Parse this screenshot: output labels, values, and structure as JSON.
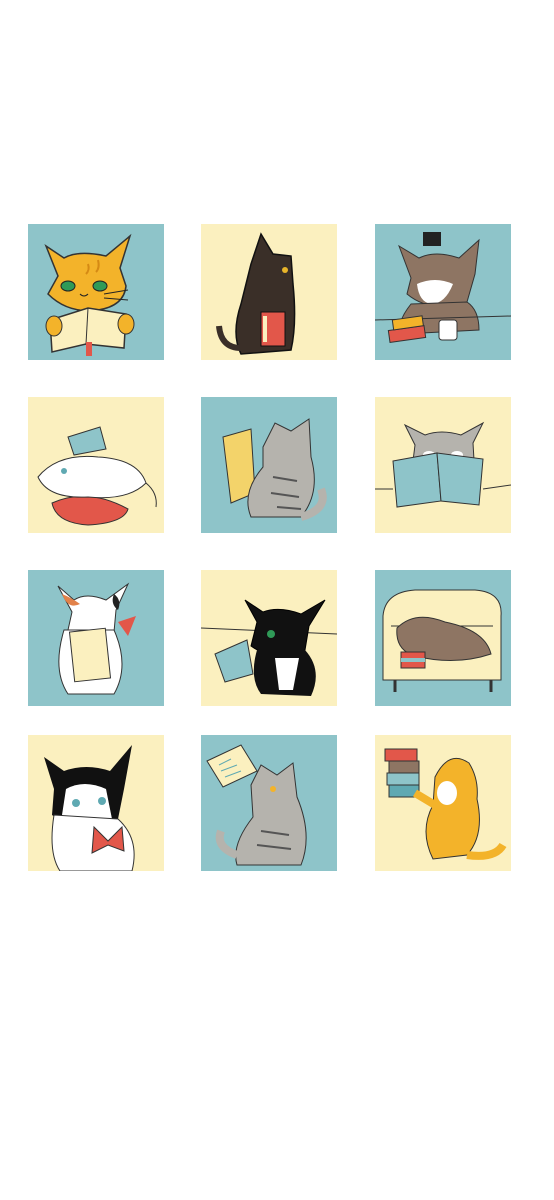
{
  "palette": {
    "teal": "#8ec4c9",
    "cream": "#fbf0bf",
    "orange": "#f3b32a",
    "red": "#e2574a",
    "gray": "#b5b3ad",
    "dark": "#222222",
    "brown": "#8e7563",
    "white": "#ffffff"
  },
  "tiles": [
    {
      "subject": "orange-tabby-cat-reading-book",
      "background": "teal"
    },
    {
      "subject": "black-cat-holding-red-book",
      "background": "cream"
    },
    {
      "subject": "brown-cat-with-hat-books-and-mug",
      "background": "teal"
    },
    {
      "subject": "white-cat-on-cushion-with-book",
      "background": "cream"
    },
    {
      "subject": "gray-tabby-cat-holding-yellow-book",
      "background": "teal"
    },
    {
      "subject": "gray-cat-behind-open-teal-book",
      "background": "cream"
    },
    {
      "subject": "calico-cat-hugging-book",
      "background": "teal"
    },
    {
      "subject": "tuxedo-cat-reading-teal-book",
      "background": "cream"
    },
    {
      "subject": "brown-cat-napping-on-sofa",
      "background": "teal"
    },
    {
      "subject": "black-white-cat-with-red-book",
      "background": "cream"
    },
    {
      "subject": "gray-tabby-cat-tossing-paper",
      "background": "teal"
    },
    {
      "subject": "yellow-cat-carrying-book-stack",
      "background": "cream"
    }
  ]
}
